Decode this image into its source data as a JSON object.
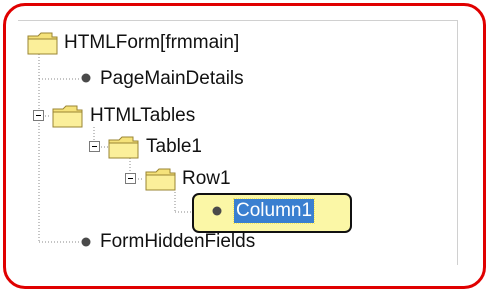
{
  "tree": {
    "root": {
      "label": "HTMLForm[frmmain]"
    },
    "page_main_details": {
      "label": "PageMainDetails"
    },
    "html_tables": {
      "label": "HTMLTables",
      "expander": "⊟"
    },
    "table1": {
      "label": "Table1",
      "expander": "⊟"
    },
    "row1": {
      "label": "Row1",
      "expander": "⊟"
    },
    "column1": {
      "label": "Column1",
      "selected": true
    },
    "form_hidden_fields": {
      "label": "FormHiddenFields"
    }
  },
  "colors": {
    "highlight_frame": "#e00000",
    "selection_background": "#3a7fd0",
    "callout_fill": "#fbf7a6",
    "folder_fill": "#f5e27a"
  },
  "icons": {
    "folder": "folder-icon",
    "leaf": "bullet-icon",
    "expander": "collapse-icon"
  }
}
